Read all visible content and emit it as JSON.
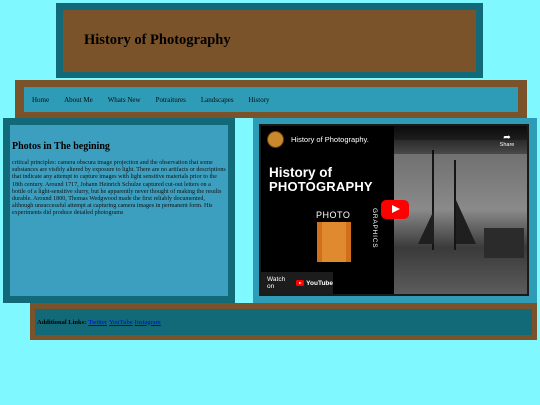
{
  "header": {
    "title": "History of Photography"
  },
  "nav": {
    "items": [
      "Home",
      "About Me",
      "Whats New",
      "Potraitures",
      "Landscapes",
      "History"
    ]
  },
  "article": {
    "title": "Photos in The begining",
    "body": "critical principles: camera obscura image projection and the observation that some substances are visibly altered by exposure to light. There are no artifacts or descriptions that indicate any attempt to capture images with light sensitive materials prior to the 18th century. Around 1717, Johann Heinrich Schulze captured cut-out letters on a bottle of a light-sensitive slurry, but he apparently never thought of making the results durable. Around 1800, Thomas Wedgwood made the first reliably documented, although unsuccessful attempt at capturing camera images in permanent form. His experiments did produce detailed photograms"
  },
  "video": {
    "title": "History of Photography.",
    "share_label": "Share",
    "thumb_line1": "History of",
    "thumb_line2": "PHOTOGRAPHY",
    "thumb_photo": "PHOTO",
    "thumb_graphics": "GRAPHICS",
    "watch_text": "Watch on",
    "youtube_word": "YouTube"
  },
  "footer": {
    "label": "Additional Links:",
    "links": [
      "Twitter",
      "YouTube",
      "Instagram"
    ]
  },
  "colors": {
    "page_bg": "#7ff8ff",
    "brown": "#7a532a",
    "dark_teal": "#126a78",
    "teal": "#2e9cb6",
    "link_blue": "#0000ee",
    "youtube_red": "#ff0000"
  },
  "icons": [
    "play-icon",
    "share-icon",
    "youtube-logo-icon",
    "film-strip-icon",
    "channel-avatar"
  ]
}
